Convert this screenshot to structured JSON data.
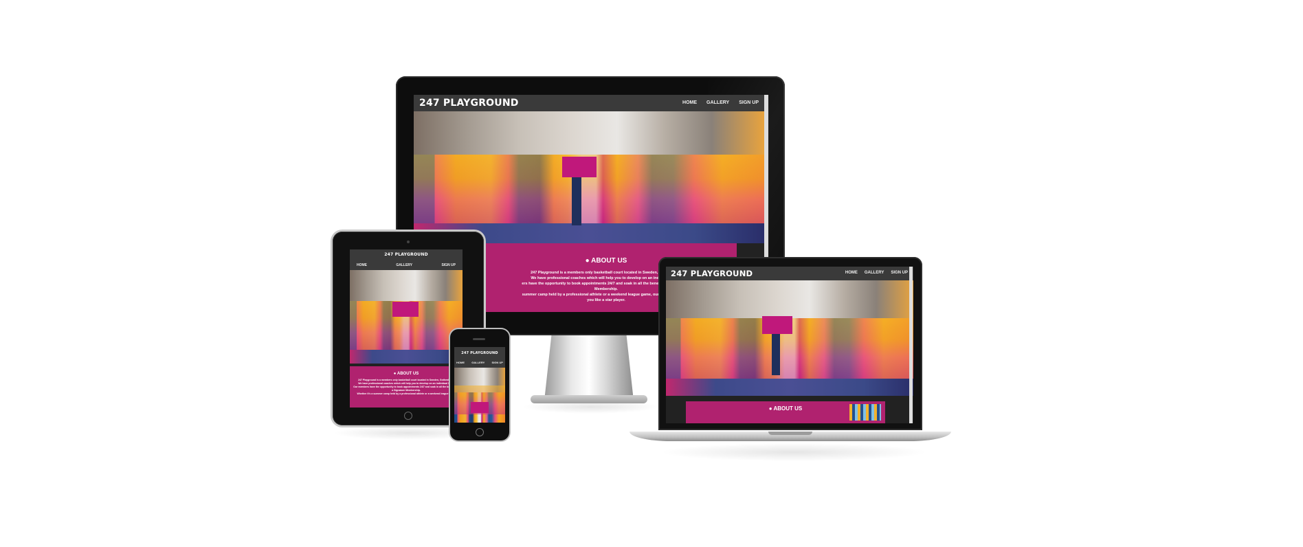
{
  "site": {
    "logo": "247 PLAYGROUND",
    "nav": [
      "HOME",
      "GALLERY",
      "SIGN UP"
    ],
    "about_title": "ABOUT US",
    "about_lines": [
      "247 Playground is a members only basketball court located in Sweden, Gothenburg.",
      "We have professional coaches which will help you to develop on an individual level.",
      "Our members have the opportunity to book appointments 24/7 and soak in all the benefits of a Signature Membership.",
      "Whether it's a summer camp held by a professional athlete or a weekend league game, our programming treats you like a star player."
    ]
  },
  "monitor": {
    "about_lines_visible": [
      "247 Playground is a members only basketball court located in Sweden, Gothenburg.",
      "We have professional coaches which will help you to develop on an individual level.",
      "ers have the opportunity to book appointments 24/7 and soak in all the benefits of a Signature",
      "Membership.",
      "summer camp held by a professional athlete or a weekend league game, our programming tre",
      "you like a star player."
    ]
  },
  "tablet": {
    "about_lines_visible": [
      "247 Playground is a members only basketball court located in Sweden, Gothenburg.",
      "We have professional coaches which will help you to develop on an individual level.",
      "Our members have the opportunity to book appointments 24/7 and soak in all the benefits of a Signature Membership.",
      "Whether it's a summer camp held by a professional athlete or a weekend league game"
    ]
  },
  "colors": {
    "nav_bg": "#3a3a3a",
    "about_bg": "#b0226f",
    "page_bg": "#ffffff"
  }
}
